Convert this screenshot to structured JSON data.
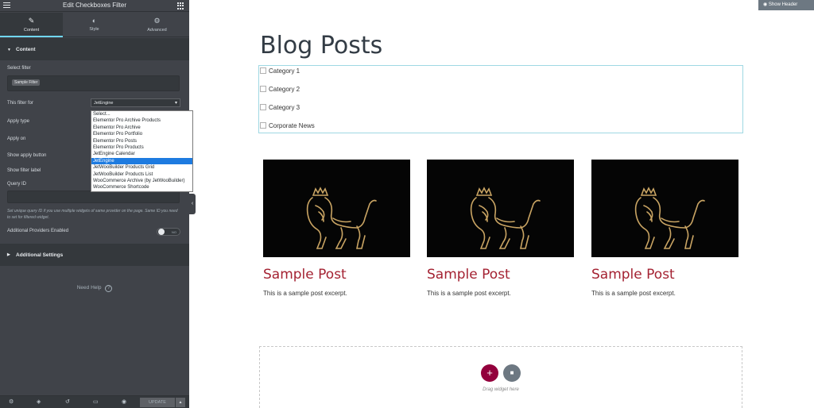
{
  "panel": {
    "title": "Edit Checkboxes Filter",
    "tabs": [
      {
        "label": "Content",
        "icon": "pencil-icon"
      },
      {
        "label": "Style",
        "icon": "half-circle-icon"
      },
      {
        "label": "Advanced",
        "icon": "gear-icon"
      }
    ],
    "content_section": "Content",
    "select_filter_label": "Select filter",
    "select_filter_value": "Sample Filter",
    "filter_for_label": "This filter for",
    "filter_for_value": "JetEngine",
    "apply_type_label": "Apply type",
    "apply_on_label": "Apply on",
    "show_apply_button_label": "Show apply button",
    "show_filter_label_label": "Show filter label",
    "query_id_label": "Query ID",
    "query_id_value": "",
    "query_id_hint": "Set unique query ID if you use multiple widgets of same provider on the page. Same ID you need to set for filtered widget.",
    "additional_providers_label": "Additional Providers Enabled",
    "additional_providers_toggle": "NO",
    "additional_settings_section": "Additional Settings",
    "need_help": "Need Help",
    "update_label": "UPDATE",
    "dropdown_options": [
      "Select...",
      "Elementor Pro Archive Products",
      "Elementor Pro Archive",
      "Elementor Pro Portfolio",
      "Elementor Pro Posts",
      "Elementor Pro Products",
      "JetEngine Calendar",
      "JetEngine",
      "JetWooBuilder Products Grid",
      "JetWooBuilder Products List",
      "WooCommerce Archive (by JetWooBuilder)",
      "WooCommerce Shortcode"
    ],
    "dropdown_selected": "JetEngine"
  },
  "preview": {
    "show_header": "Show Header",
    "page_title": "Blog Posts",
    "categories": [
      "Category 1",
      "Category 2",
      "Category 3",
      "Corporate News"
    ],
    "posts": [
      {
        "title": "Sample Post",
        "excerpt": "This is a sample post excerpt."
      },
      {
        "title": "Sample Post",
        "excerpt": "This is a sample post excerpt."
      },
      {
        "title": "Sample Post",
        "excerpt": "This is a sample post excerpt."
      }
    ],
    "drag_widget_text": "Drag widget here"
  },
  "colors": {
    "accent": "#71d7f7",
    "post_title": "#a42232",
    "add_button": "#93003c",
    "lion_gold": "#c9a463"
  }
}
